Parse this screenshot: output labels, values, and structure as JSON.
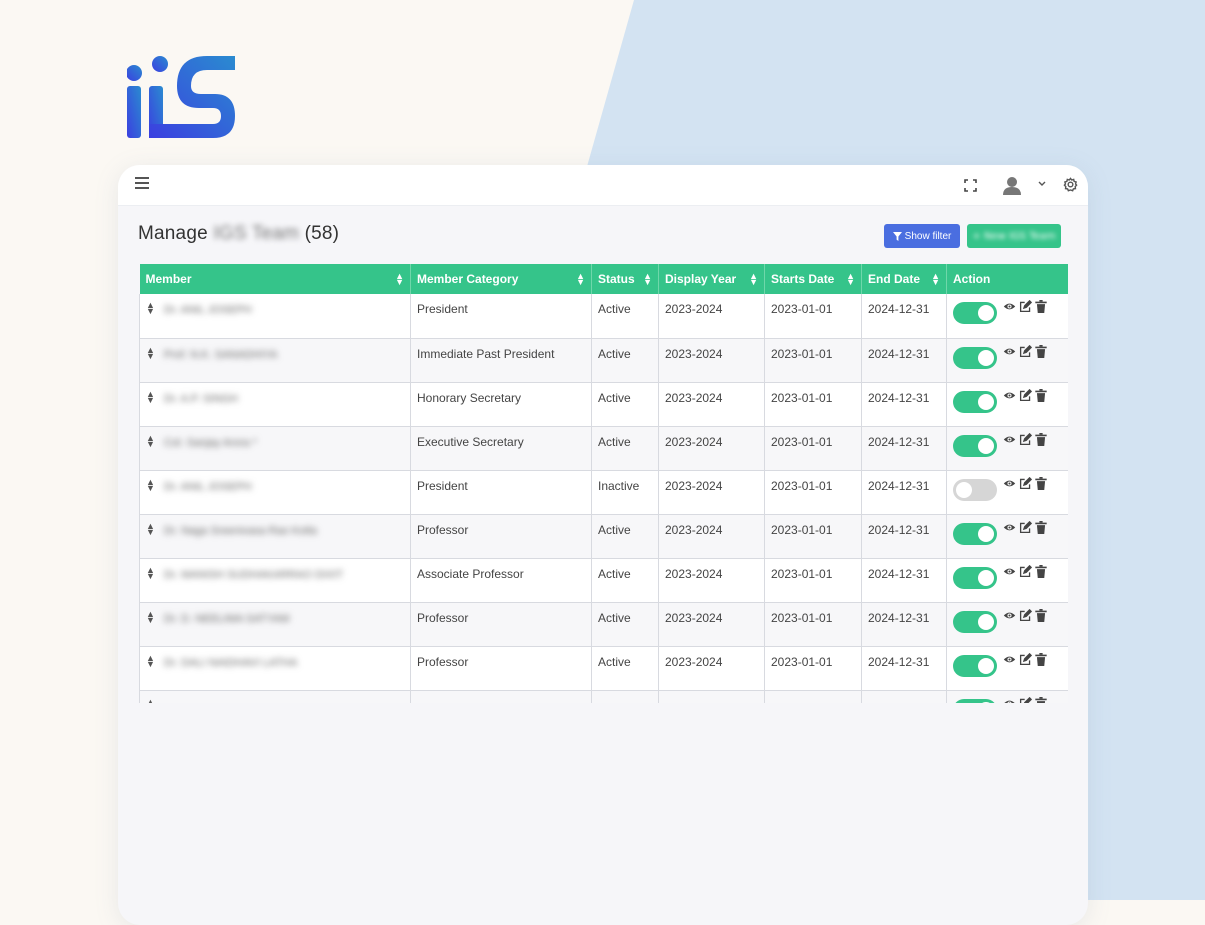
{
  "topbar": {
    "menu_icon": "hamburger-icon",
    "fullscreen_icon": "fullscreen-icon",
    "user_icon": "user-avatar-icon",
    "caret_icon": "chevron-down-icon",
    "settings_icon": "gear-icon"
  },
  "page": {
    "title_prefix": "Manage",
    "title_blurred": "IGS Team",
    "title_count": "(58)"
  },
  "buttons": {
    "show_filter": "Show filter",
    "new_label": "+ New IGS Team"
  },
  "colors": {
    "accent_green": "#35c48a",
    "filter_blue": "#4a6ee0",
    "wedge_blue": "#d3e3f2"
  },
  "table": {
    "columns": [
      "Member",
      "Member Category",
      "Status",
      "Display Year",
      "Starts Date",
      "End Date",
      "Action"
    ],
    "rows": [
      {
        "member": "Dr. ANIL JOSEPH",
        "category": "President",
        "status": "Active",
        "year": "2023-2024",
        "start": "2023-01-01",
        "end": "2024-12-31",
        "enabled": true
      },
      {
        "member": "Prof. N.K. SANADHIYA",
        "category": "Immediate Past President",
        "status": "Active",
        "year": "2023-2024",
        "start": "2023-01-01",
        "end": "2024-12-31",
        "enabled": true
      },
      {
        "member": "Dr. A.P. SINGH",
        "category": "Honorary Secretary",
        "status": "Active",
        "year": "2023-2024",
        "start": "2023-01-01",
        "end": "2024-12-31",
        "enabled": true
      },
      {
        "member": "Col. Sanjay Arora *",
        "category": "Executive Secretary",
        "status": "Active",
        "year": "2023-2024",
        "start": "2023-01-01",
        "end": "2024-12-31",
        "enabled": true
      },
      {
        "member": "Dr. ANIL JOSEPH",
        "category": "President",
        "status": "Inactive",
        "year": "2023-2024",
        "start": "2023-01-01",
        "end": "2024-12-31",
        "enabled": false
      },
      {
        "member": "Dr. Naga Sreenivasa Rao Kotla",
        "category": "Professor",
        "status": "Active",
        "year": "2023-2024",
        "start": "2023-01-01",
        "end": "2024-12-31",
        "enabled": true
      },
      {
        "member": "Dr. MANISH SUDHAKARRAO DIXIT",
        "category": "Associate Professor",
        "status": "Active",
        "year": "2023-2024",
        "start": "2023-01-01",
        "end": "2024-12-31",
        "enabled": true
      },
      {
        "member": "Dr. D. NEELIMA SATYAM",
        "category": "Professor",
        "status": "Active",
        "year": "2023-2024",
        "start": "2023-01-01",
        "end": "2024-12-31",
        "enabled": true
      },
      {
        "member": "Dr. DALI NAIDHAVI LATHA",
        "category": "Professor",
        "status": "Active",
        "year": "2023-2024",
        "start": "2023-01-01",
        "end": "2024-12-31",
        "enabled": true
      },
      {
        "member": "",
        "category": "",
        "status": "",
        "year": "",
        "start": "",
        "end": "",
        "enabled": true
      }
    ],
    "action_icons": [
      "eye-icon",
      "edit-icon",
      "trash-icon"
    ]
  }
}
